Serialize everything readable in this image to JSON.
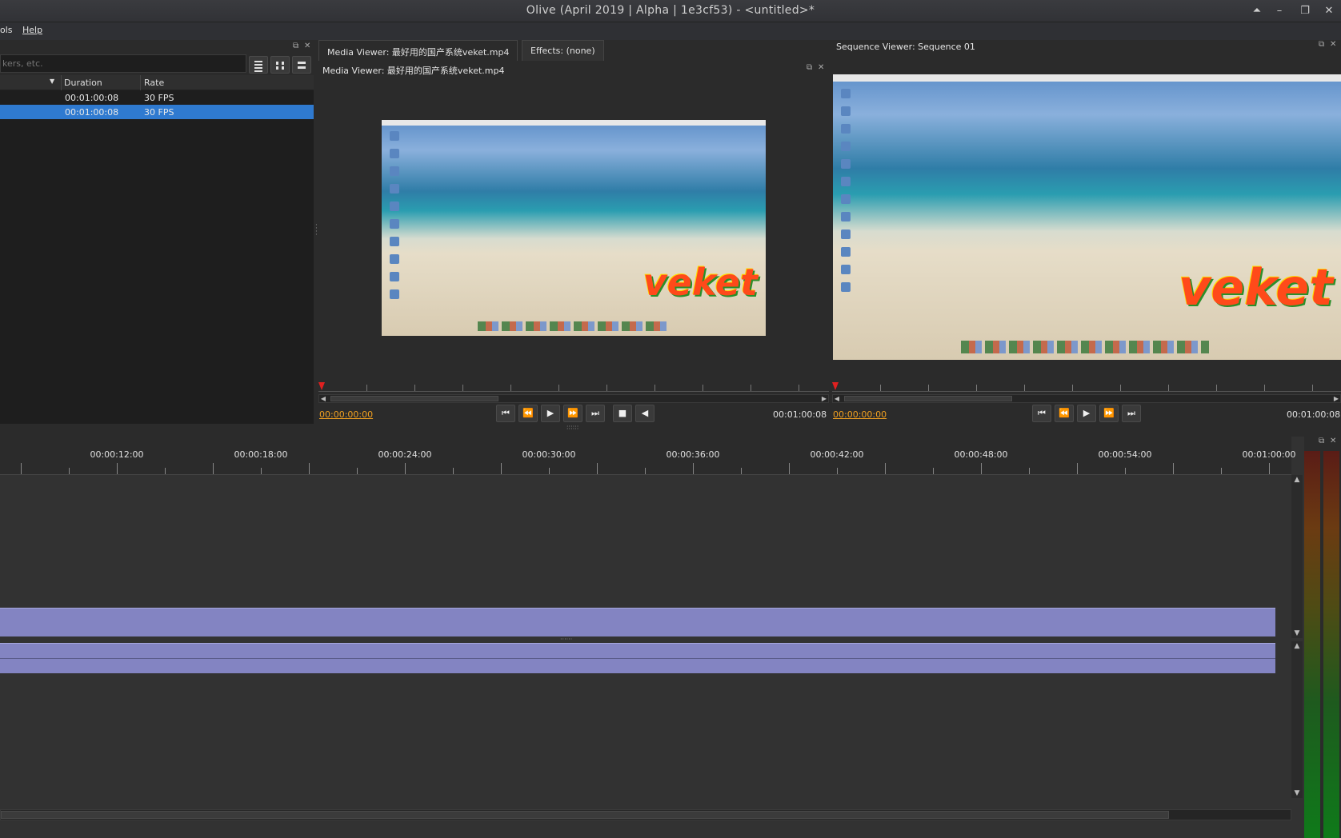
{
  "window": {
    "title": "Olive (April 2019 | Alpha | 1e3cf53) - <untitled>*",
    "buttons": [
      "⏶",
      "–",
      "❐",
      "✕"
    ]
  },
  "menubar": {
    "items": [
      "ols",
      "Help"
    ]
  },
  "project": {
    "search_placeholder": "kers, etc.",
    "columns": [
      "Duration",
      "Rate"
    ],
    "rows": [
      {
        "duration": "00:01:00:08",
        "rate": "30 FPS",
        "selected": false
      },
      {
        "duration": "00:01:00:08",
        "rate": "30 FPS",
        "selected": true
      }
    ]
  },
  "media_viewer": {
    "tabs": [
      "Media Viewer: 最好用的国产系统veket.mp4",
      "Effects: (none)"
    ],
    "title": "Media Viewer: 最好用的国产系统veket.mp4",
    "logo_text": "veket",
    "current_tc": "00:00:00:00",
    "end_tc": "00:01:00:08"
  },
  "sequence_viewer": {
    "title": "Sequence Viewer: Sequence 01",
    "logo_text": "veket",
    "current_tc": "00:00:00:00",
    "end_tc": "00:01:00:08"
  },
  "timeline": {
    "labels": [
      "00:00:12:00",
      "00:00:18:00",
      "00:00:24:00",
      "00:00:30:00",
      "00:00:36:00",
      "00:00:42:00",
      "00:00:48:00",
      "00:00:54:00",
      "00:01:00:00"
    ]
  },
  "colors": {
    "selection": "#2f7ad0",
    "clip": "#8384c2",
    "timecode": "#f0a020",
    "playhead": "#e02020"
  }
}
